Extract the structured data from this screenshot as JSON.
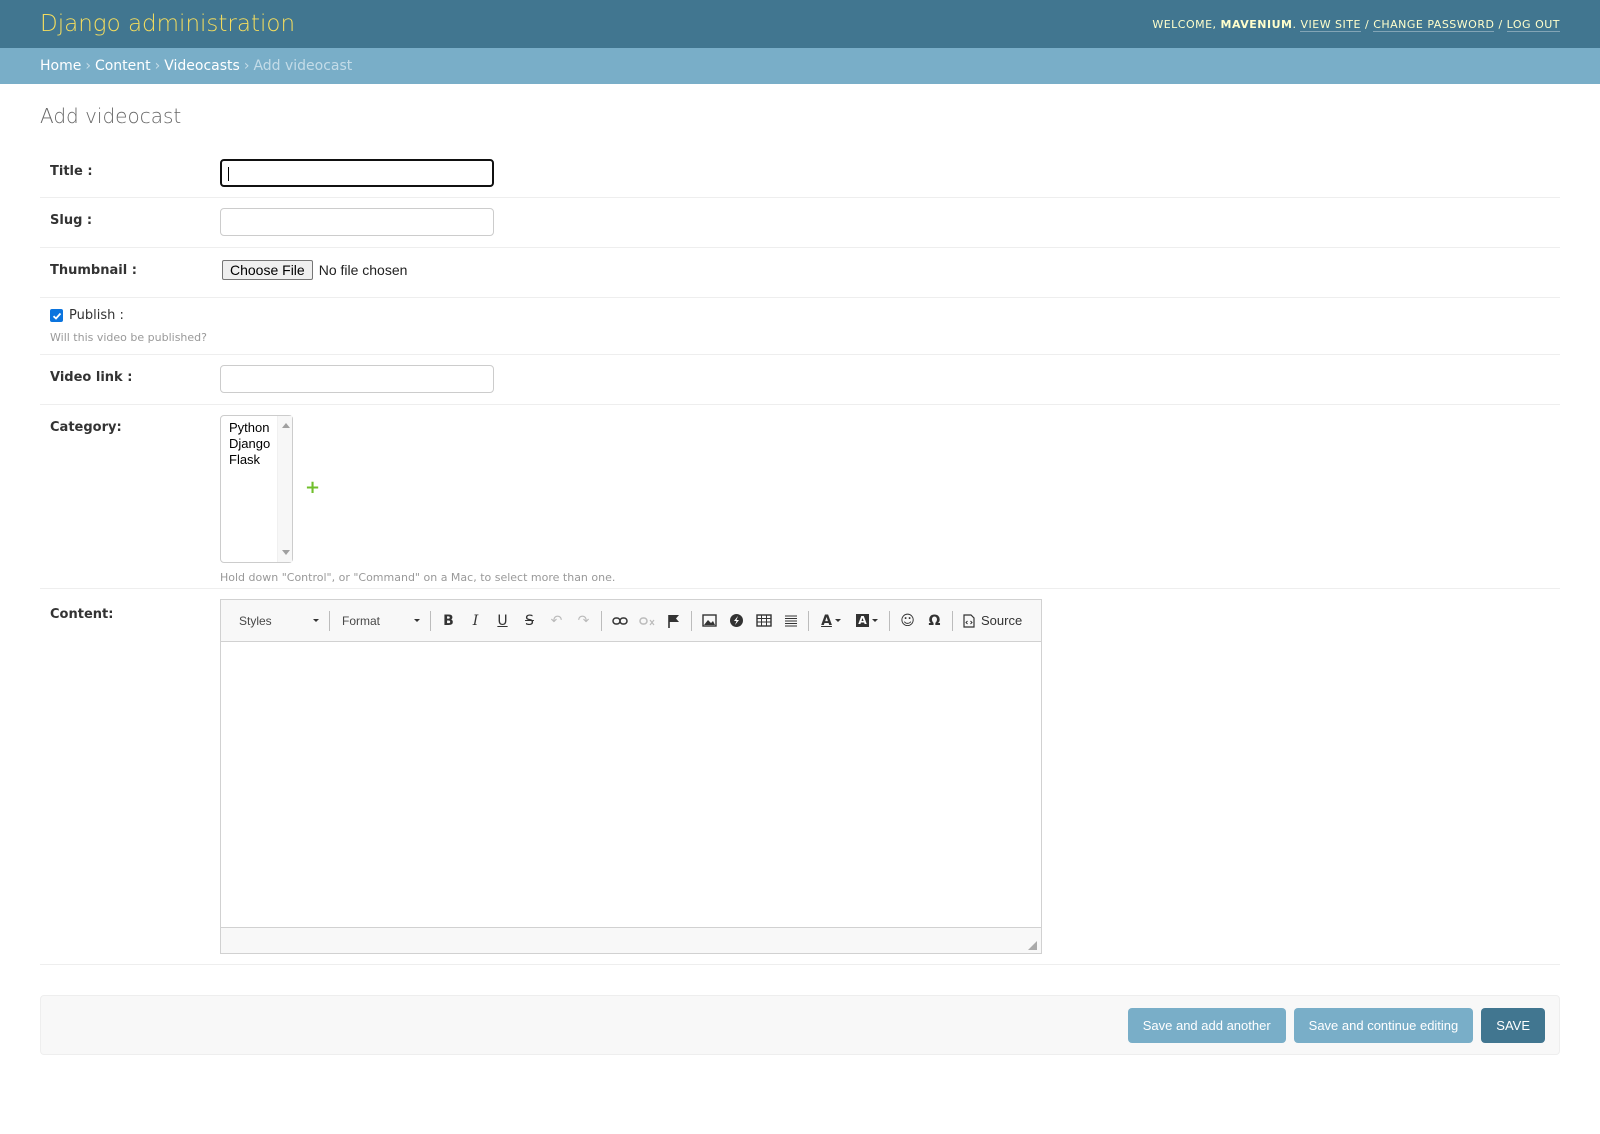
{
  "header": {
    "branding": "Django administration",
    "welcome": "WELCOME,",
    "username": "MAVENIUM",
    "view_site": "VIEW SITE",
    "change_password": "CHANGE PASSWORD",
    "log_out": "LOG OUT",
    "separator": "/"
  },
  "breadcrumbs": {
    "items": [
      "Home",
      "Content",
      "Videocasts"
    ],
    "current": "Add videocast",
    "separator": "›"
  },
  "page_title": "Add videocast",
  "form": {
    "title_label": "Title :",
    "title_value": "",
    "slug_label": "Slug :",
    "slug_value": "",
    "thumbnail_label": "Thumbnail :",
    "choose_file": "Choose File",
    "no_file": "No file chosen",
    "publish_label": "Publish :",
    "publish_checked": true,
    "publish_help": "Will this video be published?",
    "video_link_label": "Video link :",
    "video_link_value": "",
    "category_label": "Category:",
    "category_options": [
      "Python",
      "Django",
      "Flask"
    ],
    "category_add_icon": "plus-icon",
    "category_help": "Hold down \"Control\", or \"Command\" on a Mac, to select more than one.",
    "content_label": "Content:"
  },
  "editor": {
    "styles": "Styles",
    "format": "Format",
    "source": "Source",
    "icons": [
      "bold-icon",
      "italic-icon",
      "underline-icon",
      "strikethrough-icon",
      "undo-icon",
      "redo-icon",
      "link-icon",
      "unlink-icon",
      "anchor-icon",
      "image-icon",
      "flash-icon",
      "table-icon",
      "horizontal-rule-icon",
      "text-color-icon",
      "background-color-icon",
      "smiley-icon",
      "special-char-icon",
      "source-icon"
    ]
  },
  "submit": {
    "save_add_another": "Save and add another",
    "save_continue": "Save and continue editing",
    "save": "SAVE"
  },
  "colors": {
    "header_bg": "#417690",
    "breadcrumb_bg": "#79aec8",
    "branding": "#f5dd5d",
    "add_icon": "#70bf2b"
  }
}
